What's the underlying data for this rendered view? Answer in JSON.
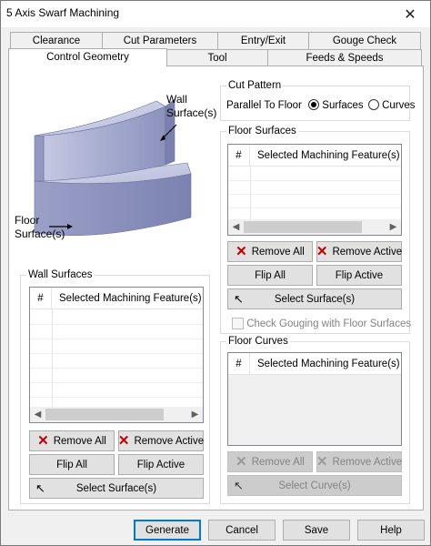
{
  "window": {
    "title": "5 Axis Swarf Machining",
    "close_glyph": "✕"
  },
  "tabs_row1": [
    "Clearance",
    "Cut Parameters",
    "Entry/Exit",
    "Gouge Check"
  ],
  "tabs_row2": [
    "Control Geometry",
    "Tool",
    "Feeds & Speeds"
  ],
  "active_tab": "Control Geometry",
  "illustration": {
    "wall_label_line1": "Wall",
    "wall_label_line2": "Surface(s)",
    "floor_label_line1": "Floor",
    "floor_label_line2": "Surface(s)"
  },
  "cut_pattern": {
    "title": "Cut Pattern",
    "label": "Parallel To Floor",
    "option_surfaces": "Surfaces",
    "option_curves": "Curves",
    "selected": "Surfaces"
  },
  "wall_surfaces": {
    "title": "Wall Surfaces",
    "col_hash": "#",
    "col_feature": "Selected Machining Feature(s)",
    "remove_all": "Remove All",
    "remove_active": "Remove Active",
    "flip_all": "Flip All",
    "flip_active": "Flip Active",
    "select": "Select Surface(s)"
  },
  "floor_surfaces": {
    "title": "Floor Surfaces",
    "col_hash": "#",
    "col_feature": "Selected Machining Feature(s)",
    "remove_all": "Remove All",
    "remove_active": "Remove Active",
    "flip_all": "Flip All",
    "flip_active": "Flip Active",
    "select": "Select Surface(s)",
    "check_gouging": "Check Gouging with Floor Surfaces",
    "check_gouging_checked": false
  },
  "floor_curves": {
    "title": "Floor Curves",
    "col_hash": "#",
    "col_feature": "Selected Machining Feature(s)",
    "remove_all": "Remove All",
    "remove_active": "Remove Active",
    "select": "Select Curve(s)"
  },
  "footer": {
    "generate": "Generate",
    "cancel": "Cancel",
    "save": "Save",
    "help": "Help"
  },
  "icons": {
    "close": "close-icon",
    "remove": "red-x-icon",
    "select": "cursor-arrow-icon",
    "scroll_left": "chevron-left-icon",
    "scroll_right": "chevron-right-icon"
  },
  "colors": {
    "accent": "#0078d7",
    "remove_x": "#c00000",
    "disabled_text": "#838383",
    "part_fill": "#a8aed0"
  }
}
